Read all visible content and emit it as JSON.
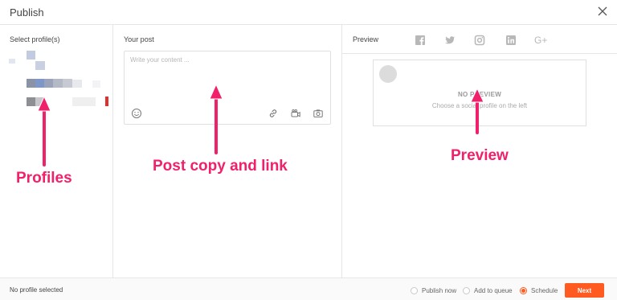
{
  "dialog": {
    "title": "Publish"
  },
  "profiles": {
    "heading": "Select profile(s)"
  },
  "post": {
    "heading": "Your post",
    "placeholder": "Write your content ..."
  },
  "preview": {
    "heading": "Preview",
    "networks": [
      "facebook",
      "twitter",
      "instagram",
      "linkedin",
      "google-plus"
    ],
    "empty_title": "NO PREVIEW",
    "empty_subtitle": "Choose a social profile on the left",
    "google_plus_label": "G+"
  },
  "annotations": {
    "profiles": "Profiles",
    "post": "Post copy and link",
    "preview": "Preview",
    "color": "#f0206a"
  },
  "footer": {
    "status": "No profile selected",
    "options": [
      {
        "label": "Publish now",
        "selected": false
      },
      {
        "label": "Add to queue",
        "selected": false
      },
      {
        "label": "Schedule",
        "selected": true
      }
    ],
    "next_label": "Next",
    "accent": "#ff5a1f"
  }
}
